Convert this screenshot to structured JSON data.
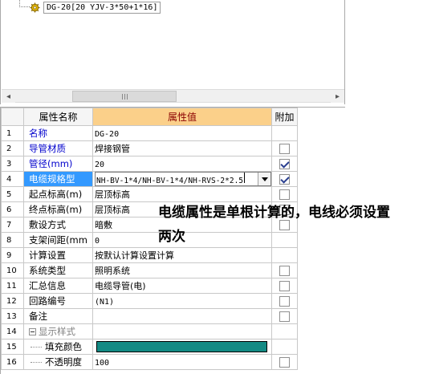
{
  "tree": {
    "node_label": "DG-20[20 YJV-3*50+1*16]",
    "node_icon": "gear-icon"
  },
  "scrollbar": {
    "left_arrow": "◂",
    "right_arrow": "▸"
  },
  "grid": {
    "headers": {
      "name": "属性名称",
      "value": "属性值",
      "attach": "附加"
    },
    "rows": [
      {
        "num": "1",
        "name": "名称",
        "value": "DG-20"
      },
      {
        "num": "2",
        "name": "导管材质",
        "value": "焊接钢管",
        "checked": false
      },
      {
        "num": "3",
        "name": "管径(mm)",
        "value": "20",
        "checked": true
      },
      {
        "num": "4",
        "name": "电缆规格型",
        "value": "NH-BV-1*4/NH-BV-1*4/NH-RVS-2*2.5",
        "checked": true
      },
      {
        "num": "5",
        "name": "起点标高(m)",
        "value": "层顶标高",
        "checked": false
      },
      {
        "num": "6",
        "name": "终点标高(m)",
        "value": "层顶标高",
        "checked": false
      },
      {
        "num": "7",
        "name": "敷设方式",
        "value": "暗敷",
        "checked": false
      },
      {
        "num": "8",
        "name": "支架间距(mm",
        "value": "0"
      },
      {
        "num": "9",
        "name": "计算设置",
        "value": "按默认计算设置计算"
      },
      {
        "num": "10",
        "name": "系统类型",
        "value": "照明系统",
        "checked": false
      },
      {
        "num": "11",
        "name": "汇总信息",
        "value": "电缆导管(电)",
        "checked": false
      },
      {
        "num": "12",
        "name": "回路编号",
        "value": "(N1)",
        "checked": false
      },
      {
        "num": "13",
        "name": "备注",
        "value": "",
        "checked": false
      },
      {
        "num": "14",
        "name": "显示样式",
        "value": ""
      },
      {
        "num": "15",
        "name": "填充颜色",
        "value": ""
      },
      {
        "num": "16",
        "name": "不透明度",
        "value": "100",
        "checked": false
      }
    ],
    "fill_color": "#138a84",
    "header_value_bg": "#fbd08a",
    "selected_bg": "#3399ff"
  },
  "annotation": {
    "line1": "电缆属性是单根计算的，电线必须设置",
    "line2": "两次"
  }
}
